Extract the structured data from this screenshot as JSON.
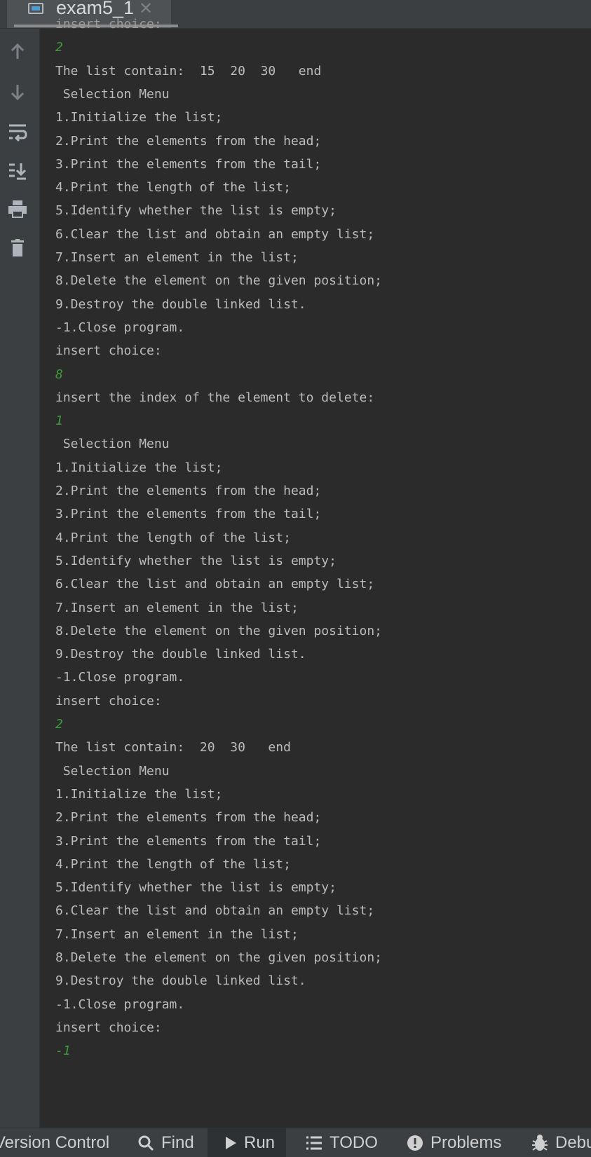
{
  "tab": {
    "title": "exam5_1",
    "close_glyph": "✕"
  },
  "gutter_icons": [
    "arrow-up-icon",
    "arrow-down-icon",
    "soft-wrap-icon",
    "scroll-to-end-icon",
    "print-icon",
    "trash-icon"
  ],
  "console_lines": [
    {
      "text": "insert choice:",
      "kind": "partial"
    },
    {
      "text": "2",
      "kind": "input"
    },
    {
      "text": "The list contain:  15  20  30   end",
      "kind": "output"
    },
    {
      "text": " Selection Menu",
      "kind": "output"
    },
    {
      "text": "1.Initialize the list;",
      "kind": "output"
    },
    {
      "text": "2.Print the elements from the head;",
      "kind": "output"
    },
    {
      "text": "3.Print the elements from the tail;",
      "kind": "output"
    },
    {
      "text": "4.Print the length of the list;",
      "kind": "output"
    },
    {
      "text": "5.Identify whether the list is empty;",
      "kind": "output"
    },
    {
      "text": "6.Clear the list and obtain an empty list;",
      "kind": "output"
    },
    {
      "text": "7.Insert an element in the list;",
      "kind": "output"
    },
    {
      "text": "8.Delete the element on the given position;",
      "kind": "output"
    },
    {
      "text": "9.Destroy the double linked list.",
      "kind": "output"
    },
    {
      "text": "-1.Close program.",
      "kind": "output"
    },
    {
      "text": "insert choice:",
      "kind": "output"
    },
    {
      "text": "8",
      "kind": "input"
    },
    {
      "text": "insert the index of the element to delete:",
      "kind": "output"
    },
    {
      "text": "1",
      "kind": "input"
    },
    {
      "text": " Selection Menu",
      "kind": "output"
    },
    {
      "text": "1.Initialize the list;",
      "kind": "output"
    },
    {
      "text": "2.Print the elements from the head;",
      "kind": "output"
    },
    {
      "text": "3.Print the elements from the tail;",
      "kind": "output"
    },
    {
      "text": "4.Print the length of the list;",
      "kind": "output"
    },
    {
      "text": "5.Identify whether the list is empty;",
      "kind": "output"
    },
    {
      "text": "6.Clear the list and obtain an empty list;",
      "kind": "output"
    },
    {
      "text": "7.Insert an element in the list;",
      "kind": "output"
    },
    {
      "text": "8.Delete the element on the given position;",
      "kind": "output"
    },
    {
      "text": "9.Destroy the double linked list.",
      "kind": "output"
    },
    {
      "text": "-1.Close program.",
      "kind": "output"
    },
    {
      "text": "insert choice:",
      "kind": "output"
    },
    {
      "text": "2",
      "kind": "input"
    },
    {
      "text": "The list contain:  20  30   end",
      "kind": "output"
    },
    {
      "text": " Selection Menu",
      "kind": "output"
    },
    {
      "text": "1.Initialize the list;",
      "kind": "output"
    },
    {
      "text": "2.Print the elements from the head;",
      "kind": "output"
    },
    {
      "text": "3.Print the elements from the tail;",
      "kind": "output"
    },
    {
      "text": "4.Print the length of the list;",
      "kind": "output"
    },
    {
      "text": "5.Identify whether the list is empty;",
      "kind": "output"
    },
    {
      "text": "6.Clear the list and obtain an empty list;",
      "kind": "output"
    },
    {
      "text": "7.Insert an element in the list;",
      "kind": "output"
    },
    {
      "text": "8.Delete the element on the given position;",
      "kind": "output"
    },
    {
      "text": "9.Destroy the double linked list.",
      "kind": "output"
    },
    {
      "text": "-1.Close program.",
      "kind": "output"
    },
    {
      "text": "insert choice:",
      "kind": "output"
    },
    {
      "text": "-1",
      "kind": "input"
    }
  ],
  "bottom_tabs": {
    "version_control": "Version Control",
    "find": "Find",
    "run": "Run",
    "todo": "TODO",
    "problems": "Problems",
    "debug": "Debug"
  },
  "colors": {
    "background": "#2b2b2b",
    "output_text": "#bbbbbb",
    "input_text": "#3c9a3c",
    "panel": "#3c3f41"
  }
}
